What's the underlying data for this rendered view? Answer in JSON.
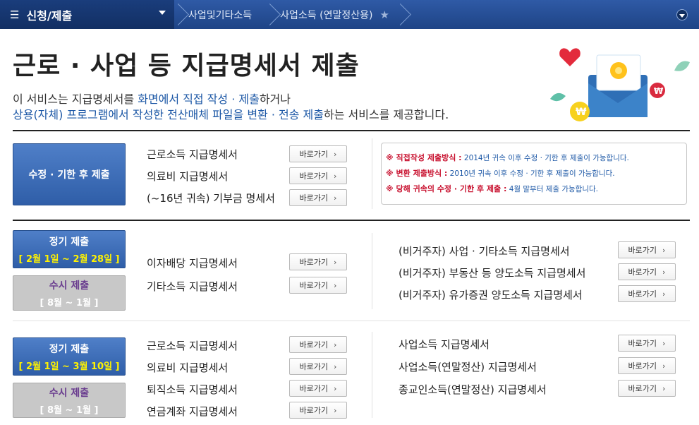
{
  "nav": {
    "menu_label": "신청/제출",
    "crumbs": [
      "사업및기타소득",
      "사업소득 (연말정산용)"
    ],
    "menu_icon": "hamburger-icon",
    "favorite_icon": "star-icon"
  },
  "page": {
    "title": "근로 · 사업 등 지급명세서 제출",
    "intro_line1_a": "이 서비스는 지급명세서를 ",
    "intro_line1_b": "화면에서 직접 작성 · 제출",
    "intro_line1_c": "하거나",
    "intro_line2_a": "상용(자체) 프로그램에서 작성한 전산매체 파일을 변환 · 전송 제출",
    "intro_line2_b": "하는 서비스를 제공합니다."
  },
  "go_label": "바로가기",
  "section1": {
    "box": "수정 · 기한 후 제출",
    "items": [
      "근로소득 지급명세서",
      "의료비 지급명세서",
      "(~16년 귀속) 기부금 명세서"
    ],
    "notices": [
      {
        "key": "※ 직접작성 제출방식 :",
        "text": " 2014년 귀속 이후 수정 · 기한 후 제출이 가능합니다."
      },
      {
        "key": "※ 변환 제출방식 :",
        "text": " 2010년 귀속 이후 수정 · 기한 후 제출이 가능합니다."
      },
      {
        "key": "※ 당해 귀속의 수정 · 기한 후 제출 :",
        "text": " 4월 말부터 제출 가능합니다."
      }
    ]
  },
  "section2": {
    "regular_title": "정기 제출",
    "regular_period": "[ 2월 1일 ~ 2월 28일 ]",
    "adhoc_title": "수시 제출",
    "adhoc_period": "[ 8월 ~ 1월 ]",
    "left_items": [
      "이자배당 지급명세서",
      "기타소득 지급명세서"
    ],
    "right_items": [
      "(비거주자) 사업 · 기타소득 지급명세서",
      "(비거주자) 부동산 등 양도소득 지급명세서",
      "(비거주자) 유가증권 양도소득 지급명세서"
    ]
  },
  "section3": {
    "regular_title": "정기 제출",
    "regular_period": "[ 2월 1일 ~ 3월 10일 ]",
    "adhoc_title": "수시 제출",
    "adhoc_period": "[ 8월 ~ 1월 ]",
    "left_items": [
      "근로소득 지급명세서",
      "의료비 지급명세서",
      "퇴직소득 지급명세서",
      "연금계좌 지급명세서"
    ],
    "right_items": [
      "사업소득 지급명세서",
      "사업소득(연말정산) 지급명세서",
      "종교인소득(연말정산) 지급명세서"
    ]
  },
  "colors": {
    "nav_bg": "#2f5aa6",
    "primary_box": "#3f6fba",
    "period_yellow": "#fff200",
    "notice_red": "#c8102e",
    "notice_blue": "#1d58a6"
  }
}
